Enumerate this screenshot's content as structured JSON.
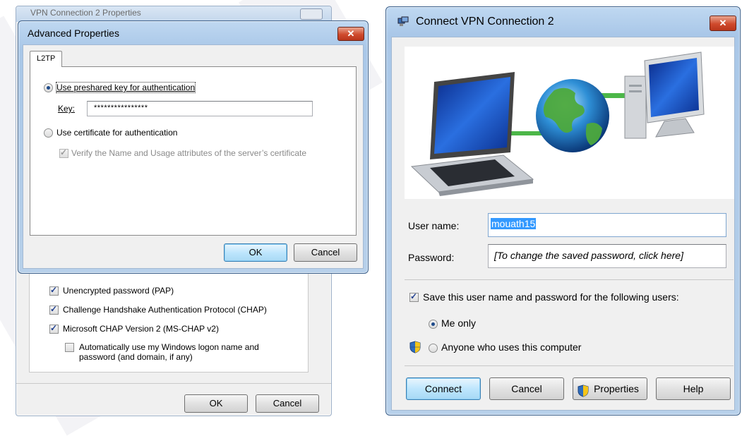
{
  "back_dialog": {
    "title": "VPN Connection 2 Properties",
    "auth_options": [
      {
        "label": "Unencrypted password (PAP)",
        "checked": true
      },
      {
        "label": "Challenge Handshake Authentication Protocol (CHAP)",
        "checked": true
      },
      {
        "label": "Microsoft CHAP Version 2 (MS-CHAP v2)",
        "checked": true
      }
    ],
    "auto_logon": {
      "line1": "Automatically use my Windows logon name and",
      "line2": "password (and domain, if any)",
      "checked": false
    },
    "ok_label": "OK",
    "cancel_label": "Cancel"
  },
  "advanced_properties": {
    "title": "Advanced Properties",
    "close_glyph": "✕",
    "tab_label": "L2TP",
    "preshared_option": "Use preshared key for authentication",
    "key_label": "Key:",
    "key_value": "****************",
    "certificate_option": "Use certificate for authentication",
    "verify_option": "Verify the Name and Usage attributes of the server’s certificate",
    "ok_label": "OK",
    "cancel_label": "Cancel"
  },
  "connect_vpn": {
    "title": "Connect VPN Connection 2",
    "close_glyph": "✕",
    "username_label": "User name:",
    "username_value": "mouath15",
    "password_label": "Password:",
    "password_hint": "[To change the saved password, click here]",
    "save_label": "Save this user name and password for the following users:",
    "save_checked": true,
    "me_only_label": "Me only",
    "anyone_label": "Anyone who uses this computer",
    "connect_label": "Connect",
    "cancel_label": "Cancel",
    "properties_label": "Properties",
    "help_label": "Help"
  },
  "colors": {
    "title_bar": "#b7d0ea",
    "close_red": "#cf4a2c",
    "default_button": "#bee6fd",
    "selection": "#3399ff"
  }
}
